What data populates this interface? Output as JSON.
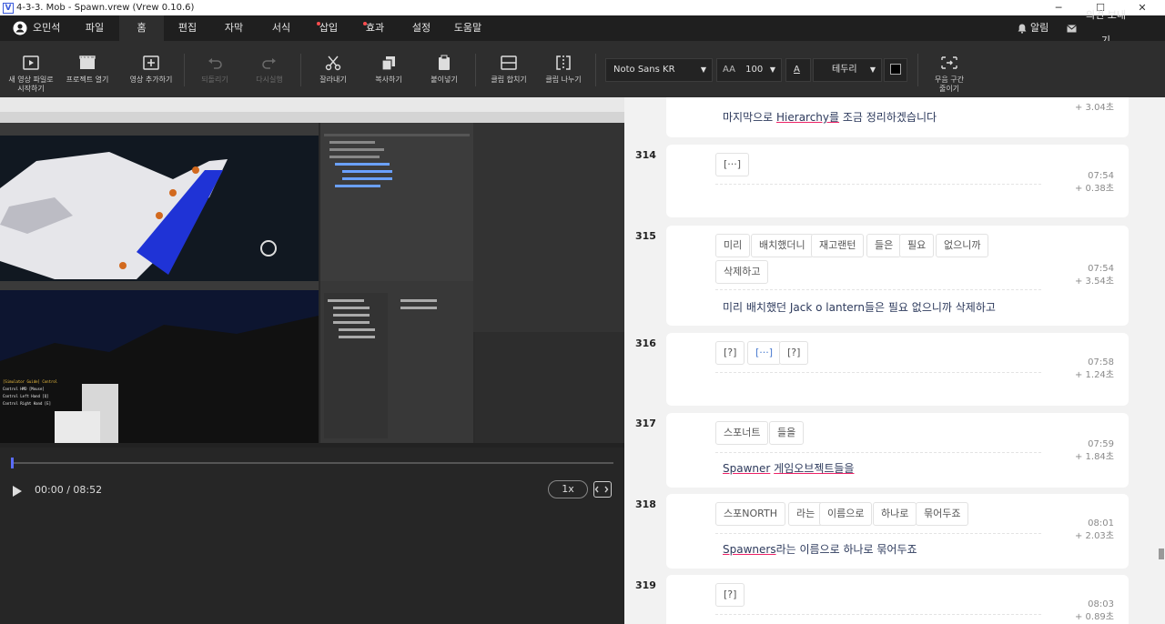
{
  "window": {
    "title": "4-3-3. Mob - Spawn.vrew (Vrew 0.10.6)",
    "logo": "V",
    "minimize": "─",
    "maximize": "☐",
    "close": "✕"
  },
  "menu": {
    "user": "오민석",
    "items": [
      "파일",
      "홈",
      "편집",
      "자막",
      "서식",
      "삽입",
      "효과",
      "설정",
      "도움말"
    ],
    "active": "홈",
    "alerts": "알림",
    "feedback": "의견 보내기"
  },
  "toolbar": {
    "new_video": [
      "새 영상 파일로",
      "시작하기"
    ],
    "open_project": "프로젝트 열기",
    "add_video": "영상 추가하기",
    "undo": "되돌리기",
    "redo": "다시실행",
    "cut": "잘라내기",
    "copy": "복사하기",
    "paste": "붙이넣기",
    "merge_clip": "클립 합치기",
    "split_clip": "클립 나누기",
    "font": "Noto Sans KR",
    "font_size": "100",
    "border": "테두리",
    "silence": [
      "무음 구간",
      "줄이기"
    ]
  },
  "player": {
    "time": "00:00 / 08:52",
    "speed": "1x"
  },
  "clips": [
    {
      "num": "",
      "chips": [],
      "time": "",
      "dur": "+ 3.04초",
      "caption": "마지막으로 Hierarchy를 조금 정리하겠습니다"
    },
    {
      "num": "314",
      "chips": [
        "[···]"
      ],
      "time": "07:54",
      "dur": "+ 0.38초",
      "caption": ""
    },
    {
      "num": "315",
      "chips": [
        "미리",
        "배치했더니",
        "재고랜턴",
        "들은",
        "필요",
        "없으니까",
        "삭제하고"
      ],
      "time": "07:54",
      "dur": "+ 3.54초",
      "caption": "미리 배치했던 Jack o lantern들은 필요 없으니까 삭제하고"
    },
    {
      "num": "316",
      "chips": [
        "[?]",
        "[···]",
        "[?]"
      ],
      "time": "07:58",
      "dur": "+ 1.24초",
      "caption": ""
    },
    {
      "num": "317",
      "chips": [
        "스포너트",
        "들을"
      ],
      "time": "07:59",
      "dur": "+ 1.84초",
      "caption_a": "Spawner",
      "caption_b": "게임오브젝트들을"
    },
    {
      "num": "318",
      "chips": [
        "스포NORTH",
        "라는",
        "이름으로",
        "하나로",
        "묶어두죠"
      ],
      "time": "08:01",
      "dur": "+ 2.03초",
      "caption_a": "Spawners",
      "caption_b": "라는 이름으로 하나로 묶어두죠"
    },
    {
      "num": "319",
      "chips": [
        "[?]"
      ],
      "time": "08:03",
      "dur": "+ 0.89초",
      "caption": ""
    }
  ],
  "colors": {
    "accent": "#4a7bd0",
    "menubar": "#1f1f1f",
    "toolbar": "#2e2e2e",
    "panel": "#f2f2f2"
  }
}
